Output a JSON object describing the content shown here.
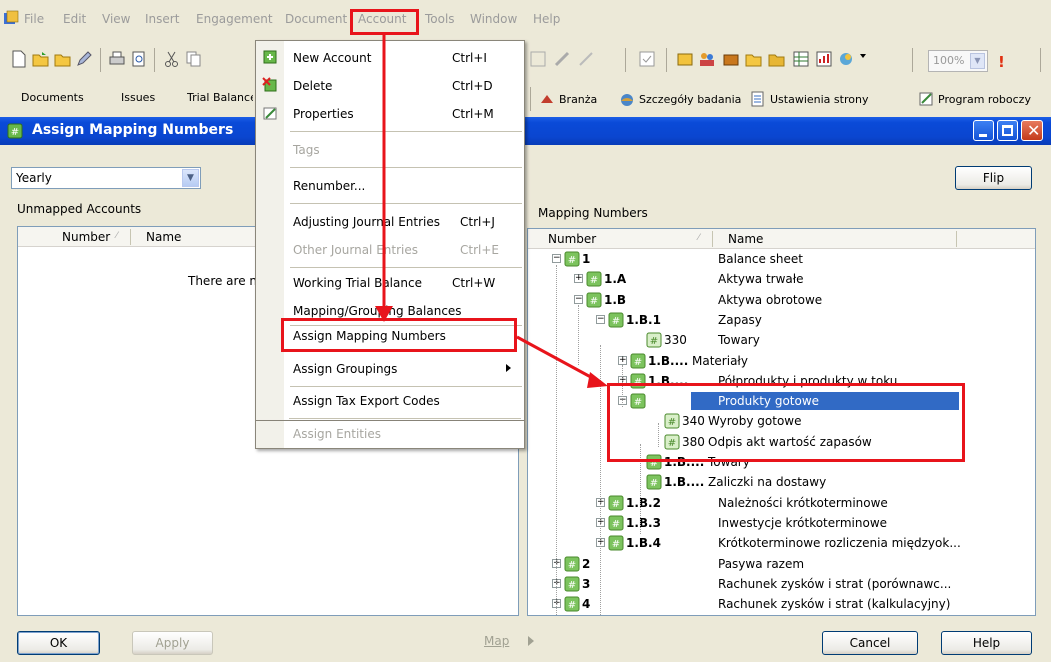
{
  "menubar": {
    "items": [
      "File",
      "Edit",
      "View",
      "Insert",
      "Engagement",
      "Document",
      "Account",
      "Tools",
      "Window",
      "Help"
    ]
  },
  "toolbar": {
    "zoom": "100%"
  },
  "toolbar2": {
    "items": [
      "Documents",
      "Issues",
      "Trial Balance"
    ],
    "right_items": [
      "Branża",
      "Szczegóły badania",
      "Ustawienia strony",
      "Program roboczy"
    ]
  },
  "window": {
    "title": "Assign Mapping Numbers"
  },
  "left_panel": {
    "period": "Yearly",
    "label": "Unmapped Accounts",
    "columns": [
      "Number",
      "Name"
    ],
    "empty_message": "There are n"
  },
  "right_panel": {
    "flip_label": "Flip",
    "label": "Mapping Numbers",
    "columns": [
      "Number",
      "Name"
    ],
    "rows": [
      {
        "number": "1",
        "name": "Balance sheet",
        "bold": true
      },
      {
        "number": "1.A",
        "name": "Aktywa trwałe",
        "bold": true
      },
      {
        "number": "1.B",
        "name": "Aktywa obrotowe",
        "bold": true
      },
      {
        "number": "1.B.1",
        "name": "Zapasy",
        "bold": true
      },
      {
        "number": "330",
        "name": "Towary",
        "bold": false
      },
      {
        "number": "1.B....",
        "name": "Materiały",
        "bold": true
      },
      {
        "number": "1.B....",
        "name": "Półprodukty i produkty w toku",
        "bold": true
      },
      {
        "number": "1.B....",
        "name": "Produkty gotowe",
        "bold": true
      },
      {
        "number": "340",
        "name": "Wyroby gotowe",
        "bold": false
      },
      {
        "number": "380",
        "name": "Odpis akt wartość zapasów",
        "bold": false
      },
      {
        "number": "1.B....",
        "name": "Towary",
        "bold": true
      },
      {
        "number": "1.B....",
        "name": "Zaliczki na dostawy",
        "bold": true
      },
      {
        "number": "1.B.2",
        "name": "Należności krótkoterminowe",
        "bold": true
      },
      {
        "number": "1.B.3",
        "name": "Inwestycje krótkoterminowe",
        "bold": true
      },
      {
        "number": "1.B.4",
        "name": "Krótkoterminowe rozliczenia międzyok...",
        "bold": true
      },
      {
        "number": "2",
        "name": "Pasywa razem",
        "bold": true
      },
      {
        "number": "3",
        "name": "Rachunek zysków i strat (porównawc...",
        "bold": true
      },
      {
        "number": "4",
        "name": "Rachunek zysków i strat (kalkulacyjny)",
        "bold": true
      }
    ]
  },
  "buttons": {
    "ok": "OK",
    "apply": "Apply",
    "map": "Map",
    "cancel": "Cancel",
    "help": "Help"
  },
  "account_menu": {
    "new_account": {
      "label": "New Account",
      "shortcut": "Ctrl+I"
    },
    "delete": {
      "label": "Delete",
      "shortcut": "Ctrl+D"
    },
    "properties": {
      "label": "Properties",
      "shortcut": "Ctrl+M"
    },
    "tags": {
      "label": "Tags"
    },
    "renumber": {
      "label": "Renumber..."
    },
    "adjusting": {
      "label": "Adjusting Journal Entries",
      "shortcut": "Ctrl+J"
    },
    "other_journal": {
      "label": "Other Journal Entries",
      "shortcut": "Ctrl+E"
    },
    "working_tb": {
      "label": "Working Trial Balance",
      "shortcut": "Ctrl+W"
    },
    "mapping_balances": {
      "label": "Mapping/Grouping Balances"
    },
    "assign_mapping": {
      "label": "Assign Mapping Numbers"
    },
    "assign_groupings": {
      "label": "Assign Groupings"
    },
    "assign_tax": {
      "label": "Assign Tax Export Codes"
    },
    "assign_entities": {
      "label": "Assign Entities"
    }
  },
  "colors": {
    "titlebar": "#0a46d0",
    "selection": "#316ac5",
    "annotation": "#e8141b"
  }
}
